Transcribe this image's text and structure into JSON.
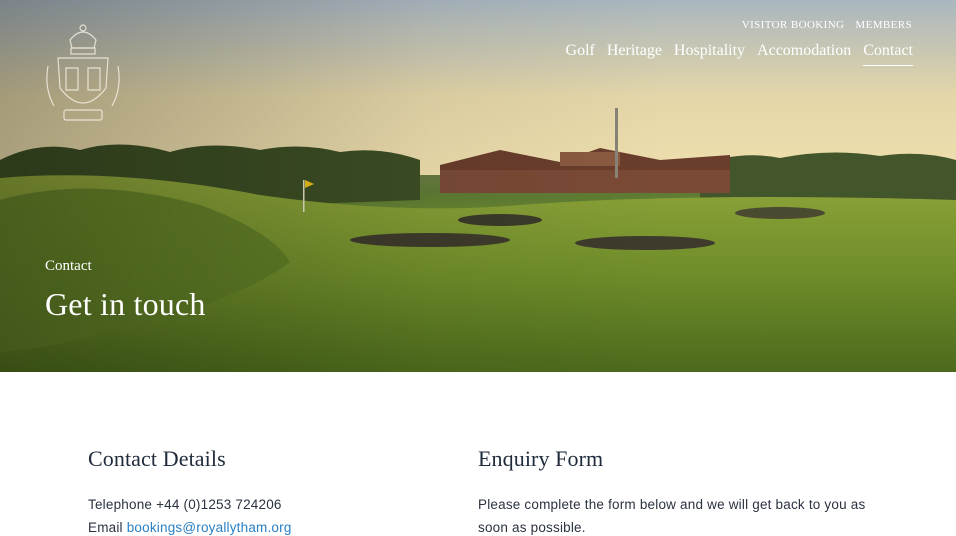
{
  "header": {
    "utility_nav": [
      "VISITOR BOOKING",
      "MEMBERS"
    ],
    "main_nav": [
      {
        "label": "Golf",
        "active": false
      },
      {
        "label": "Heritage",
        "active": false
      },
      {
        "label": "Hospitality",
        "active": false
      },
      {
        "label": "Accomodation",
        "active": false
      },
      {
        "label": "Contact",
        "active": true
      }
    ],
    "logo_icon": "club-crest-icon"
  },
  "hero": {
    "breadcrumb": "Contact",
    "title": "Get in touch"
  },
  "contact_details": {
    "heading": "Contact Details",
    "telephone_label": "Telephone",
    "telephone": "+44 (0)1253 724206",
    "email_label": "Email",
    "email": "bookings@royallytham.org"
  },
  "enquiry_form": {
    "heading": "Enquiry Form",
    "intro": "Please complete the form below and we will get back to you as soon as possible."
  },
  "colors": {
    "link": "#2a7fc4",
    "heading": "#1f2a3a",
    "hero_text": "#ffffff"
  }
}
